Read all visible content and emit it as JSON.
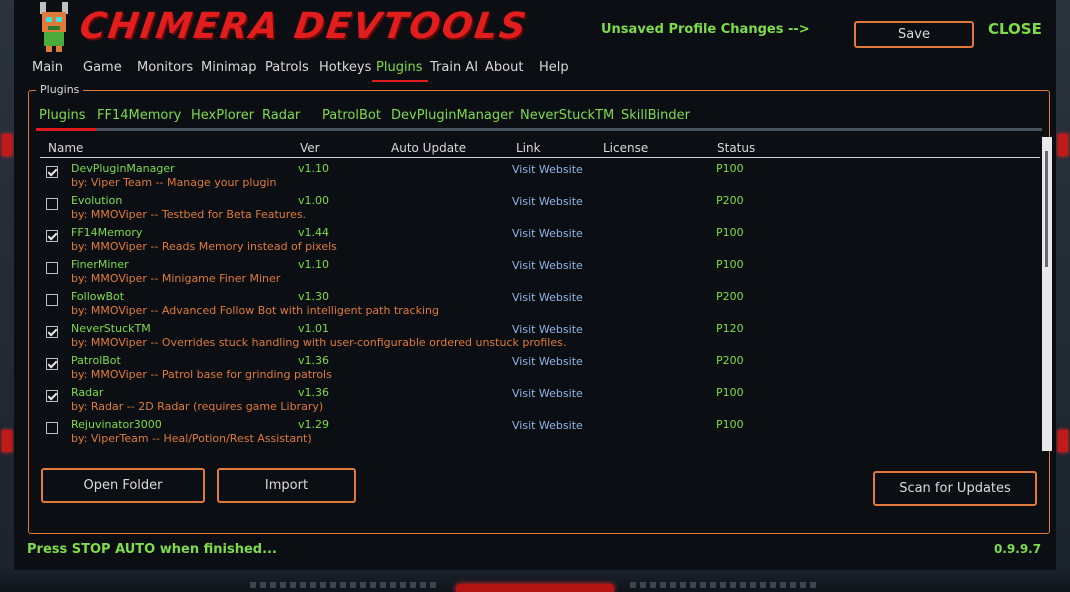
{
  "header": {
    "title": "CHIMERA DEVTOOLS",
    "unsaved_text": "Unsaved Profile Changes -->",
    "save_label": "Save",
    "close_label": "CLOSE"
  },
  "menu": {
    "items": [
      "Main",
      "Game",
      "Monitors",
      "Minimap",
      "Patrols",
      "Hotkeys",
      "Plugins",
      "Train AI",
      "About",
      "Help"
    ],
    "active": "Plugins"
  },
  "group": {
    "title": "Plugins"
  },
  "subtabs": {
    "items": [
      "Plugins",
      "FF14Memory",
      "HexPlorer",
      "Radar",
      "PatrolBot",
      "DevPluginManager",
      "NeverStuckTM",
      "SkillBinder"
    ],
    "active": "Plugins"
  },
  "table": {
    "columns": [
      "Name",
      "Ver",
      "Auto Update",
      "Link",
      "License",
      "Status"
    ],
    "rows": [
      {
        "checked": true,
        "name": "DevPluginManager",
        "desc": "by: Viper Team -- Manage your plugin",
        "ver": "v1.10",
        "link": "Visit Website",
        "status": "P100"
      },
      {
        "checked": false,
        "name": "Evolution",
        "desc": "by: MMOViper -- Testbed for Beta Features.",
        "ver": "v1.00",
        "link": "Visit Website",
        "status": "P200"
      },
      {
        "checked": true,
        "name": "FF14Memory",
        "desc": "by: MMOViper -- Reads Memory instead of pixels",
        "ver": "v1.44",
        "link": "Visit Website",
        "status": "P100"
      },
      {
        "checked": false,
        "name": "FinerMiner",
        "desc": "by: MMOViper -- Minigame Finer Miner",
        "ver": "v1.10",
        "link": "Visit Website",
        "status": "P100"
      },
      {
        "checked": false,
        "name": "FollowBot",
        "desc": "by: MMOViper -- Advanced Follow Bot with intelligent path tracking",
        "ver": "v1.30",
        "link": "Visit Website",
        "status": "P200"
      },
      {
        "checked": true,
        "name": "NeverStuckTM",
        "desc": "by: MMOViper -- Overrides stuck handling with user-configurable ordered unstuck profiles.",
        "ver": "v1.01",
        "link": "Visit Website",
        "status": "P120"
      },
      {
        "checked": true,
        "name": "PatrolBot",
        "desc": "by: MMOViper -- Patrol base for grinding patrols",
        "ver": "v1.36",
        "link": "Visit Website",
        "status": "P200"
      },
      {
        "checked": true,
        "name": "Radar",
        "desc": "by: Radar -- 2D Radar (requires game Library)",
        "ver": "v1.36",
        "link": "Visit Website",
        "status": "P100"
      },
      {
        "checked": false,
        "name": "Rejuvinator3000",
        "desc": "by: ViperTeam -- Heal/Potion/Rest Assistant)",
        "ver": "v1.29",
        "link": "Visit Website",
        "status": "P100"
      }
    ]
  },
  "buttons": {
    "open_folder": "Open Folder",
    "import": "Import",
    "scan_updates": "Scan for Updates"
  },
  "footer": {
    "message": "Press STOP AUTO when finished...",
    "version": "0.9.9.7"
  },
  "colors": {
    "accent_green": "#7ddc4a",
    "accent_orange": "#e07a3a",
    "accent_red": "#e01a1a",
    "link_blue": "#8fb4e8"
  }
}
